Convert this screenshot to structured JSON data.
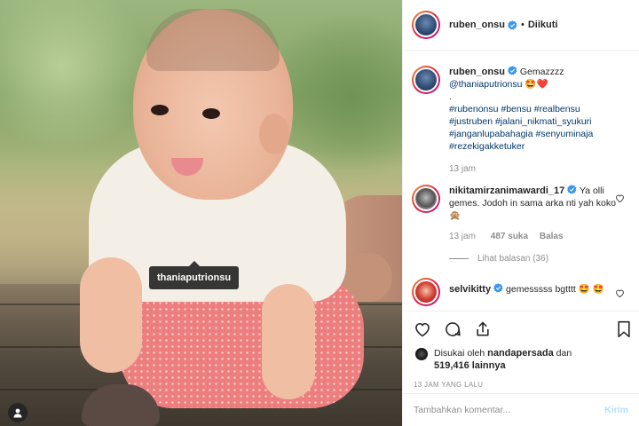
{
  "photo": {
    "tag_tooltip": "thaniaputrionsu"
  },
  "header": {
    "username": "ruben_onsu",
    "separator": "•",
    "follow_status": "Diikuti"
  },
  "caption": {
    "username": "ruben_onsu",
    "text": "Gemazzzz",
    "mention": "@thaniaputrionsu",
    "emoji": "🤩❤️",
    "dot": ".",
    "hashtags": "#rubenonsu #bensu #realbensu #justruben #jalani_nikmati_syukuri #janganlupabahagia #senyuminaja #rezekigakketuker",
    "time": "13 jam"
  },
  "comments": [
    {
      "username": "nikitamirzanimawardi_17",
      "text": "Ya olli gemes. Jodoh in sama arka nti yah koko 🙊",
      "time": "13 jam",
      "likes": "487 suka",
      "reply": "Balas",
      "view_replies": "Lihat balasan (36)"
    },
    {
      "username": "selvikitty",
      "text": "gemesssss bgtttt 🤩 🤩"
    }
  ],
  "likes": {
    "prefix": "Disukai oleh",
    "user": "nandapersada",
    "connector": "dan",
    "count": "519,416",
    "suffix": "lainnya"
  },
  "timestamp": "13 JAM YANG LALU",
  "add_comment": {
    "placeholder": "Tambahkan komentar...",
    "post_label": "Kirim"
  },
  "colors": {
    "verified": "#3897f0",
    "link": "#00376b",
    "muted": "#8e8e8e",
    "post_disabled": "#b2dffc"
  }
}
